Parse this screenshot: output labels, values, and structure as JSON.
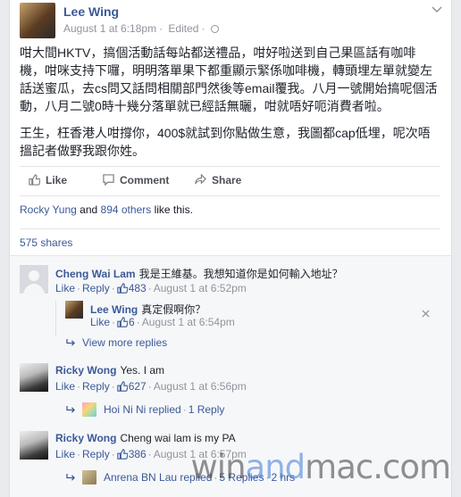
{
  "post": {
    "author": "Lee Wing",
    "time": "August 1 at 6:18pm",
    "edited": "Edited",
    "paragraphs": [
      "咁大間HKTV，搞個活動話每站都送禮品，咁好啦送到自己果區話有咖啡機，咁咪支持下囉，明明落單果下都重顯示緊係咖啡機，轉頭埋左單就變左話送蜜瓜，去cs問又話問相關部門然後等email覆我。八月一號開始搞呢個活動，八月二號0時十幾分落單就已經話無曬，咁就唔好呃消費者啦。",
      "王生，枉香港人咁撐你，400$就試到你點做生意，我圖都cap低埋，呢次唔搵記者做野我跟你姓。"
    ],
    "actions": {
      "like": "Like",
      "comment": "Comment",
      "share": "Share"
    },
    "likes": {
      "name": "Rocky Yung",
      "joiner": " and ",
      "others": "894 others",
      "suffix": " like this."
    },
    "shares": "575 shares"
  },
  "comments": [
    {
      "name": "Cheng Wai Lam",
      "text": "我是王維基。我想知道你是如何輸入地址？",
      "like": "Like",
      "reply": "Reply",
      "likes": "483",
      "time": "August 1 at 6:52pm",
      "replies": [
        {
          "name": "Lee Wing",
          "text": "真定假啊你？",
          "like": "Like",
          "likes": "6",
          "time": "August 1 at 6:54pm"
        }
      ],
      "view_more": "View more replies"
    },
    {
      "name": "Ricky Wong",
      "text": "Yes. I am",
      "like": "Like",
      "reply": "Reply",
      "likes": "627",
      "time": "August 1 at 6:56pm",
      "replied": {
        "name": "Hoi Ni Ni replied",
        "count": "1 Reply"
      }
    },
    {
      "name": "Ricky Wong",
      "text": "Cheng wai lam is my PA",
      "like": "Like",
      "reply": "Reply",
      "likes": "386",
      "time": "August 1 at 6:57pm",
      "replied": {
        "name": "Anrena BN Lau replied",
        "count": "5 Replies",
        "time": "2 hrs"
      }
    }
  ],
  "watermark": {
    "part1": "win",
    "part2": "and",
    "part3": "mac.com"
  },
  "colors": {
    "link": "#3b5998",
    "muted": "#90949c",
    "watermark_accent": "#3c7ad6"
  }
}
